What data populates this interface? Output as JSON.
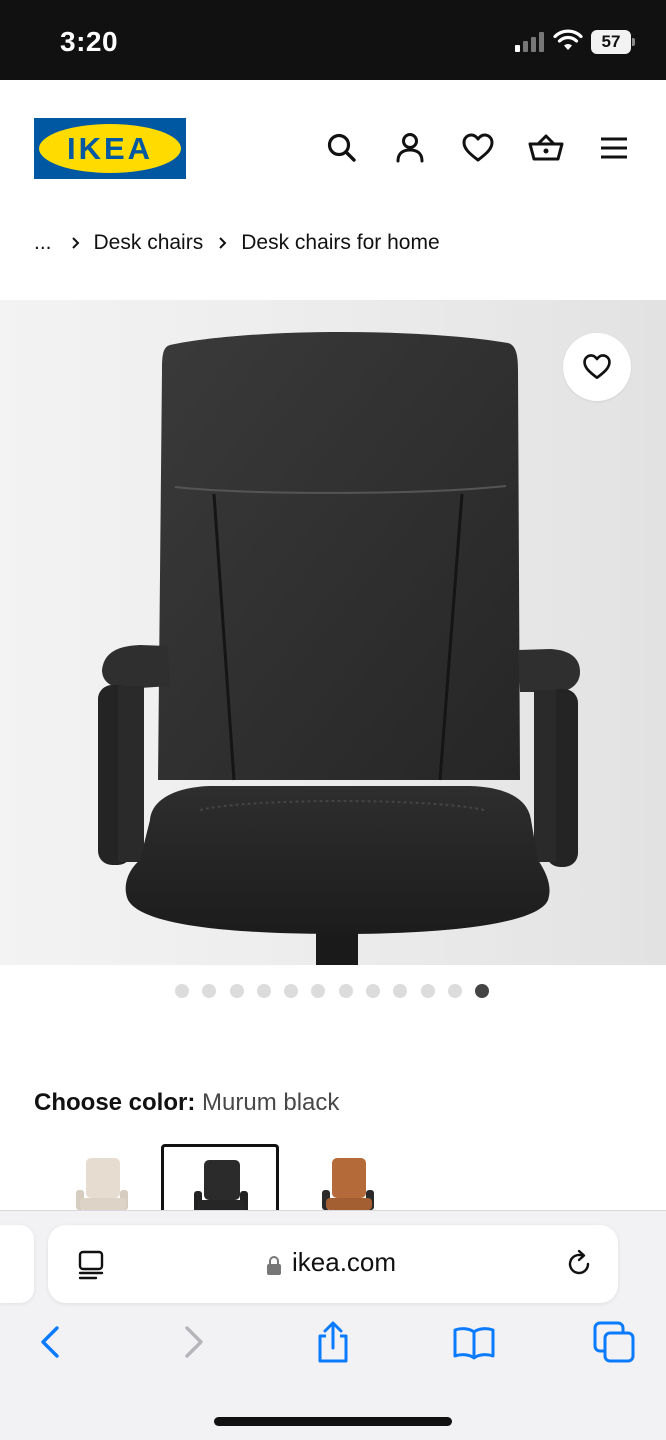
{
  "status_bar": {
    "time": "3:20",
    "battery": "57"
  },
  "header": {
    "logo_text": "IKEA",
    "icons": [
      "search-icon",
      "profile-icon",
      "heart-icon",
      "cart-icon",
      "menu-icon"
    ]
  },
  "breadcrumb": {
    "ellipsis": "...",
    "items": [
      "Desk chairs",
      "Desk chairs for home"
    ]
  },
  "gallery": {
    "total_images": 12,
    "active_index": 11,
    "favorite_icon": "heart-outline-icon"
  },
  "color_chooser": {
    "label": "Choose color:",
    "selected": "Murum black",
    "swatches": [
      {
        "name": "beige",
        "color": "#e6ddd0",
        "selected": false
      },
      {
        "name": "black",
        "color": "#2b2b2b",
        "selected": true
      },
      {
        "name": "brown",
        "color": "#b56a3a",
        "selected": false
      }
    ]
  },
  "browser": {
    "url": "ikea.com",
    "toolbar": [
      "back-icon",
      "forward-icon",
      "share-icon",
      "bookmarks-icon",
      "tabs-icon"
    ]
  },
  "colors": {
    "ikea_blue": "#0058a3",
    "ikea_yellow": "#ffdb00",
    "safari_blue": "#0a7aff"
  }
}
